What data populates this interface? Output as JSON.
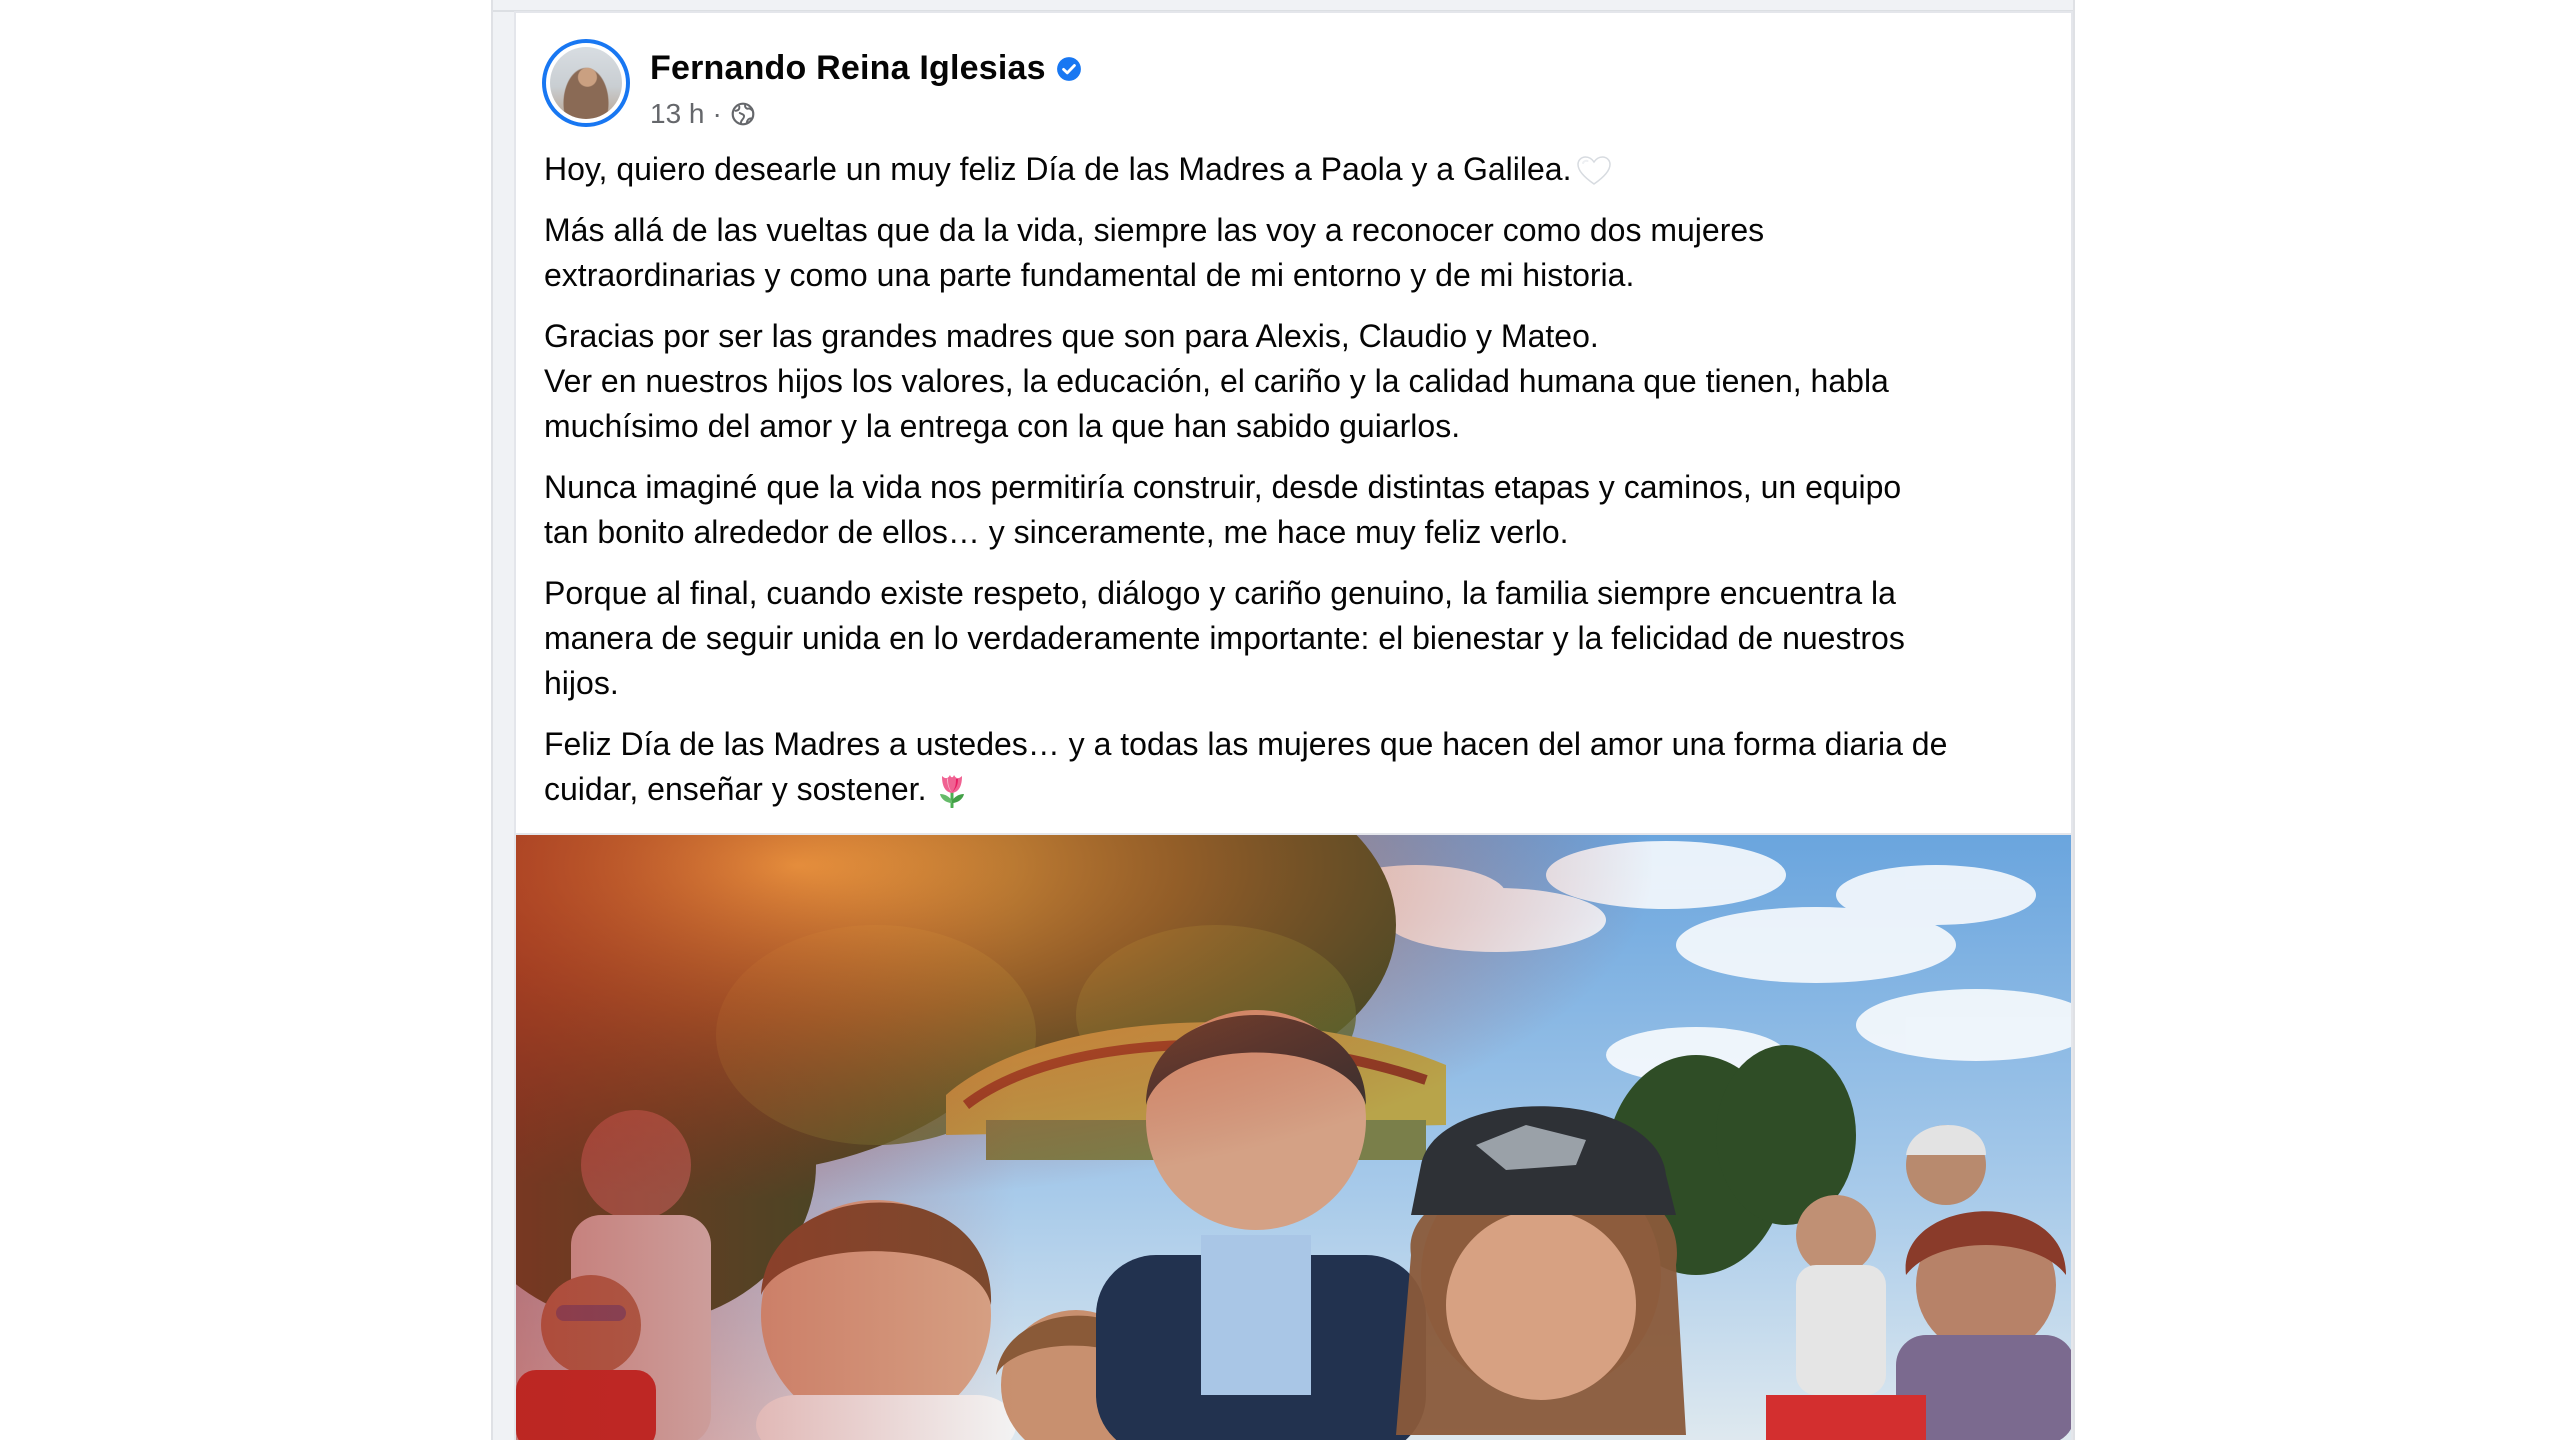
{
  "post": {
    "author": {
      "name": "Fernando Reina Iglesias",
      "verified": true
    },
    "meta": {
      "time": "13 h",
      "separator": "·",
      "audience_icon": "globe-icon"
    },
    "paragraphs": {
      "p1": "Hoy, quiero desearle un muy feliz Día de las Madres a Paola y a Galilea.",
      "p2": "Más allá de las vueltas que da la vida, siempre las voy a reconocer como dos mujeres\nextraordinarias y como una parte fundamental de mi entorno y de mi historia.",
      "p3": "Gracias por ser las grandes madres que son para Alexis, Claudio y Mateo.\nVer en nuestros hijos los valores, la educación, el cariño y la calidad humana que tienen, habla\nmuchísimo del amor y la entrega con la que han sabido guiarlos.",
      "p4": "Nunca imaginé que la vida nos permitiría construir, desde distintas etapas y caminos, un equipo\ntan bonito alrededor de ellos… y sinceramente, me hace muy feliz verlo.",
      "p5": "Porque al final, cuando existe respeto, diálogo y cariño genuino, la familia siempre encuentra la\nmanera de seguir unida en lo verdaderamente importante: el bienestar y la felicidad de nuestros\nhijos.",
      "p6": "Feliz Día de las Madres a ustedes… y a todas las mujeres que hacen del amor una forma diaria de\ncuidar, enseñar y sostener."
    },
    "emojis": {
      "p1_end": "white-heart-emoji",
      "p6_end": "tulip-emoji"
    }
  },
  "colors": {
    "brand_blue": "#1877f2",
    "text_primary": "#050505",
    "text_secondary": "#65676b",
    "feed_background": "#f0f2f5"
  }
}
